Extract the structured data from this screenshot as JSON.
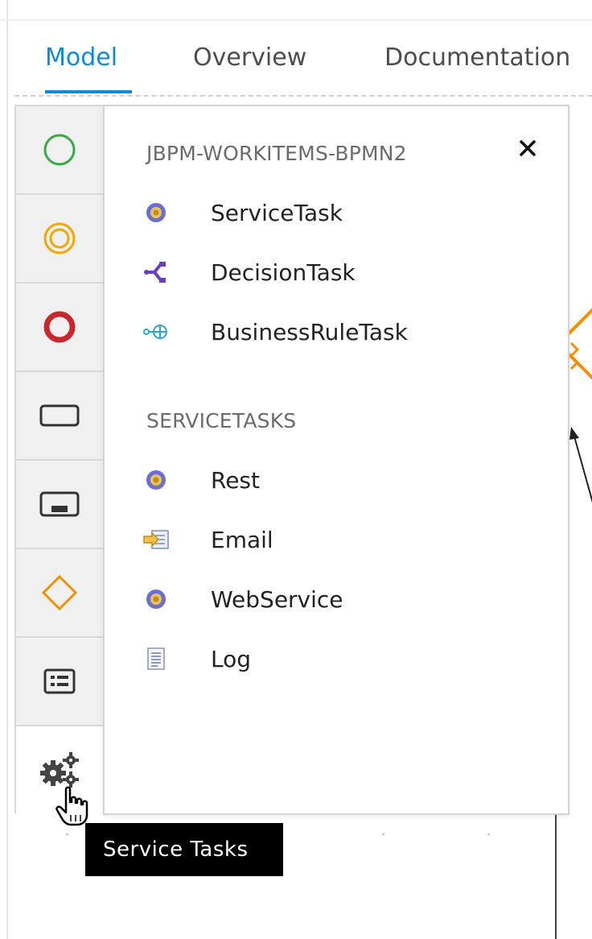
{
  "tabs": [
    {
      "label": "Model",
      "active": true
    },
    {
      "label": "Overview",
      "active": false
    },
    {
      "label": "Documentation",
      "active": false
    }
  ],
  "palette": {
    "items": [
      {
        "name": "start-event",
        "icon": "circle-thin-green"
      },
      {
        "name": "intermediate-event",
        "icon": "double-circle-orange"
      },
      {
        "name": "end-event",
        "icon": "circle-thick-red"
      },
      {
        "name": "task",
        "icon": "rounded-rectangle"
      },
      {
        "name": "subprocess",
        "icon": "rectangle-with-bar"
      },
      {
        "name": "gateway",
        "icon": "diamond-orange"
      },
      {
        "name": "container",
        "icon": "list-box"
      },
      {
        "name": "service-tasks",
        "icon": "gears",
        "active": true
      }
    ]
  },
  "flyout": {
    "sections": [
      {
        "title": "JBPM-WORKITEMS-BPMN2",
        "items": [
          {
            "label": "ServiceTask",
            "icon": "gear-icon"
          },
          {
            "label": "DecisionTask",
            "icon": "decision-icon"
          },
          {
            "label": "BusinessRuleTask",
            "icon": "business-rule-icon"
          }
        ]
      },
      {
        "title": "SERVICETASKS",
        "items": [
          {
            "label": "Rest",
            "icon": "gear-icon"
          },
          {
            "label": "Email",
            "icon": "email-icon"
          },
          {
            "label": "WebService",
            "icon": "gear-icon"
          },
          {
            "label": "Log",
            "icon": "document-icon"
          }
        ]
      }
    ],
    "close_glyph": "×"
  },
  "tooltip": {
    "text": "Service Tasks"
  },
  "colors": {
    "accent": "#0f8ad6",
    "start": "#3aa846",
    "intermediate": "#f0a800",
    "end": "#c8282d",
    "gateway": "#f29000"
  }
}
